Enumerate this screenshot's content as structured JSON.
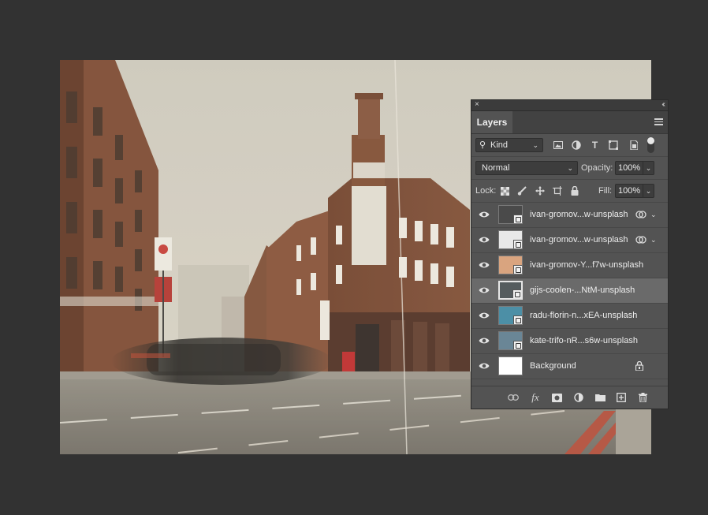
{
  "panel": {
    "close_glyph": "×",
    "collapse_glyph": "‹‹",
    "tab_label": "Layers",
    "filter": {
      "kind_label": "Kind",
      "icons": [
        "image-filter-icon",
        "adjustment-filter-icon",
        "type-filter-icon",
        "shape-filter-icon",
        "smart-object-filter-icon"
      ]
    },
    "blend_mode": "Normal",
    "opacity_label": "Opacity:",
    "opacity_value": "100%",
    "lock_label": "Lock:",
    "fill_label": "Fill:",
    "fill_value": "100%",
    "layers": [
      {
        "name": "ivan-gromov...w-unsplash",
        "thumb": "#4a4a4a",
        "smart": true,
        "linked": true,
        "expandable": true
      },
      {
        "name": "ivan-gromov...w-unsplash",
        "thumb": "#e8e8e8",
        "smart": true,
        "linked": true,
        "expandable": true
      },
      {
        "name": "ivan-gromov-Y...f7w-unsplash",
        "thumb": "#d9a47f",
        "smart": true
      },
      {
        "name": "gijs-coolen-...NtM-unsplash",
        "thumb": "#555c5e",
        "smart": true,
        "selected": true
      },
      {
        "name": "radu-florin-n...xEA-unsplash",
        "thumb": "#4c8fa6",
        "smart": true
      },
      {
        "name": "kate-trifo-nR...s6w-unsplash",
        "thumb": "#6a8696",
        "smart": true
      },
      {
        "name": "Background",
        "thumb": "#ffffff",
        "locked": true
      }
    ],
    "footer_icons": [
      "link-layers-icon",
      "fx-icon",
      "mask-icon",
      "adjustment-layer-icon",
      "group-folder-icon",
      "new-layer-icon",
      "trash-icon"
    ],
    "fx_glyph": "fx"
  },
  "colors": {
    "workspace": "#323232",
    "panel": "#535353",
    "selected_row": "#6a6a6a"
  }
}
